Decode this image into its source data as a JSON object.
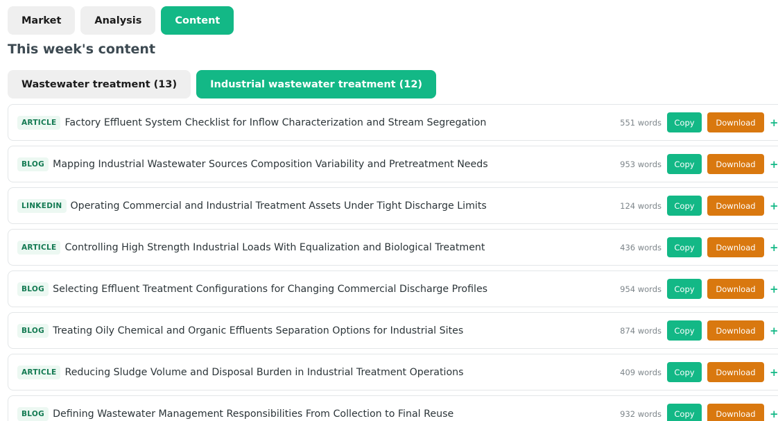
{
  "top_tabs": [
    {
      "label": "Market",
      "active": false
    },
    {
      "label": "Analysis",
      "active": false
    },
    {
      "label": "Content",
      "active": true
    }
  ],
  "section_title": "This week's content",
  "sub_tabs": [
    {
      "label": "Wastewater treatment (13)",
      "active": false
    },
    {
      "label": "Industrial wastewater treatment (12)",
      "active": true
    }
  ],
  "actions": {
    "copy_label": "Copy",
    "download_label": "Download",
    "add_label": "+"
  },
  "items": [
    {
      "type": "ARTICLE",
      "title": "Factory Effluent System Checklist for Inflow Characterization and Stream Segregation",
      "words": "551 words"
    },
    {
      "type": "BLOG",
      "title": "Mapping Industrial Wastewater Sources Composition Variability and Pretreatment Needs",
      "words": "953 words"
    },
    {
      "type": "LINKEDIN",
      "title": "Operating Commercial and Industrial Treatment Assets Under Tight Discharge Limits",
      "words": "124 words"
    },
    {
      "type": "ARTICLE",
      "title": "Controlling High Strength Industrial Loads With Equalization and Biological Treatment",
      "words": "436 words"
    },
    {
      "type": "BLOG",
      "title": "Selecting Effluent Treatment Configurations for Changing Commercial Discharge Profiles",
      "words": "954 words"
    },
    {
      "type": "BLOG",
      "title": "Treating Oily Chemical and Organic Effluents Separation Options for Industrial Sites",
      "words": "874 words"
    },
    {
      "type": "ARTICLE",
      "title": "Reducing Sludge Volume and Disposal Burden in Industrial Treatment Operations",
      "words": "409 words"
    },
    {
      "type": "BLOG",
      "title": "Defining Wastewater Management Responsibilities From Collection to Final Reuse",
      "words": "932 words"
    }
  ],
  "colors": {
    "accent_green": "#13b886",
    "download_orange": "#d9780f",
    "badge_text": "#137a52"
  }
}
